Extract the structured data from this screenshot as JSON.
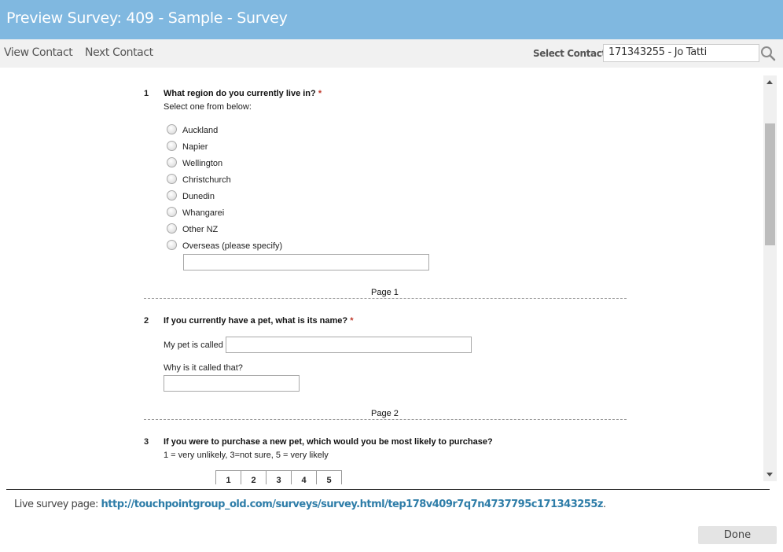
{
  "window": {
    "title": "Preview Survey: 409 - Sample - Survey"
  },
  "toolbar": {
    "view_contact": "View Contact",
    "next_contact": "Next Contact",
    "select_contact_label": "Select Contact",
    "select_contact_value": "171343255 - Jo Tatti",
    "search_icon": "search-icon"
  },
  "survey": {
    "questions": [
      {
        "number": "1",
        "text": "What region do you currently live in?",
        "required_mark": "*",
        "instruction": "Select one from below:",
        "options": [
          "Auckland",
          "Napier",
          "Wellington",
          "Christchurch",
          "Dunedin",
          "Whangarei",
          "Other NZ",
          "Overseas (please specify)"
        ],
        "specify_value": ""
      },
      {
        "number": "2",
        "text": "If you currently have a pet, what is its name?",
        "required_mark": "*",
        "field1_label": "My pet is called",
        "field1_value": "",
        "field2_label": "Why is it called that?",
        "field2_value": ""
      },
      {
        "number": "3",
        "text": "If you were to purchase a new pet, which would you be most likely to purchase?",
        "instruction": "1 = very unlikely, 3=not sure, 5 = very likely",
        "scale": [
          "1",
          "2",
          "3",
          "4",
          "5"
        ]
      }
    ],
    "page_breaks": [
      "Page 1",
      "Page 2"
    ]
  },
  "footer": {
    "live_label": "Live survey page: ",
    "live_url": "http://touchpointgroup_old.com/surveys/survey.html/tep178v409r7q7n4737795c171343255z",
    "live_suffix": ".",
    "done_label": "Done"
  },
  "colors": {
    "titlebar": "#80b8e0",
    "link": "#2e7da8",
    "required": "#c0392b"
  }
}
